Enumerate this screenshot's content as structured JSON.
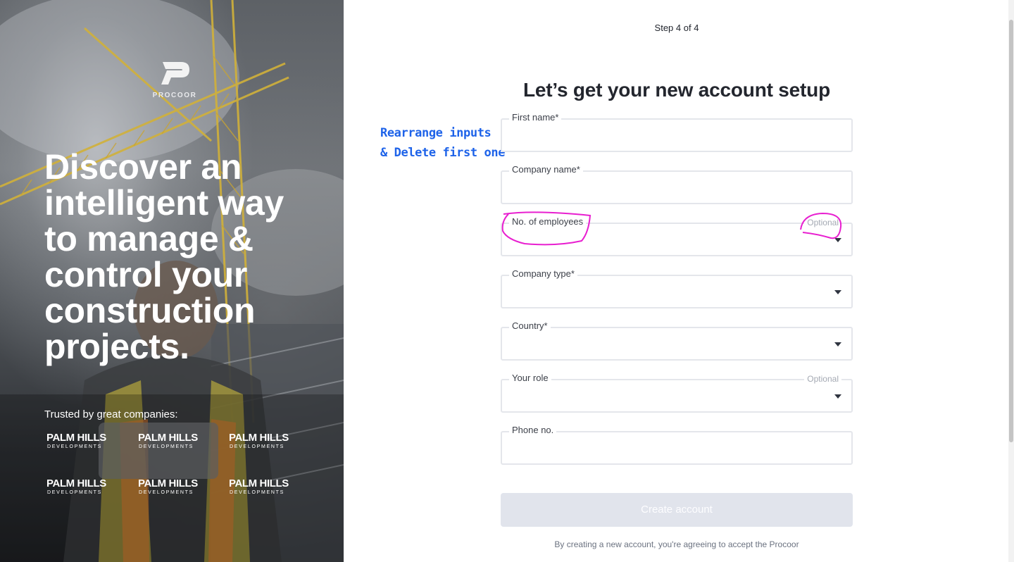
{
  "hero": {
    "brand": "PROCOOR",
    "title": "Discover an intelligent way to manage & control your construction projects.",
    "trusted_label": "Trusted by great companies:",
    "partner_logos": [
      {
        "line1": "PALM HILLS",
        "line2": "DEVELOPMENTS"
      },
      {
        "line1": "PALM HILLS",
        "line2": "DEVELOPMENTS"
      },
      {
        "line1": "PALM HILLS",
        "line2": "DEVELOPMENTS"
      },
      {
        "line1": "PALM HILLS",
        "line2": "DEVELOPMENTS"
      },
      {
        "line1": "PALM HILLS",
        "line2": "DEVELOPMENTS"
      },
      {
        "line1": "PALM HILLS",
        "line2": "DEVELOPMENTS"
      }
    ]
  },
  "form": {
    "step": "Step 4 of 4",
    "heading": "Let’s get your new account setup",
    "annotation": {
      "line1": "Rearrange inputs",
      "line2": "& Delete first one"
    },
    "fields": {
      "first_name": {
        "label": "First name*",
        "value": ""
      },
      "company_name": {
        "label": "Company name*",
        "value": ""
      },
      "employees": {
        "label": "No. of employees",
        "optional": "Optional",
        "value": ""
      },
      "company_type": {
        "label": "Company type*",
        "value": ""
      },
      "country": {
        "label": "Country*",
        "value": ""
      },
      "role": {
        "label": "Your role",
        "optional": "Optional",
        "value": ""
      },
      "phone": {
        "label": "Phone no.",
        "value": ""
      }
    },
    "submit_label": "Create account",
    "terms": "By creating a new account, you're agreeing to accept the Procoor"
  },
  "colors": {
    "annotation_blue": "#1e63e9",
    "annotation_pink": "#e81fd0",
    "button_disabled": "#e1e4ec"
  }
}
